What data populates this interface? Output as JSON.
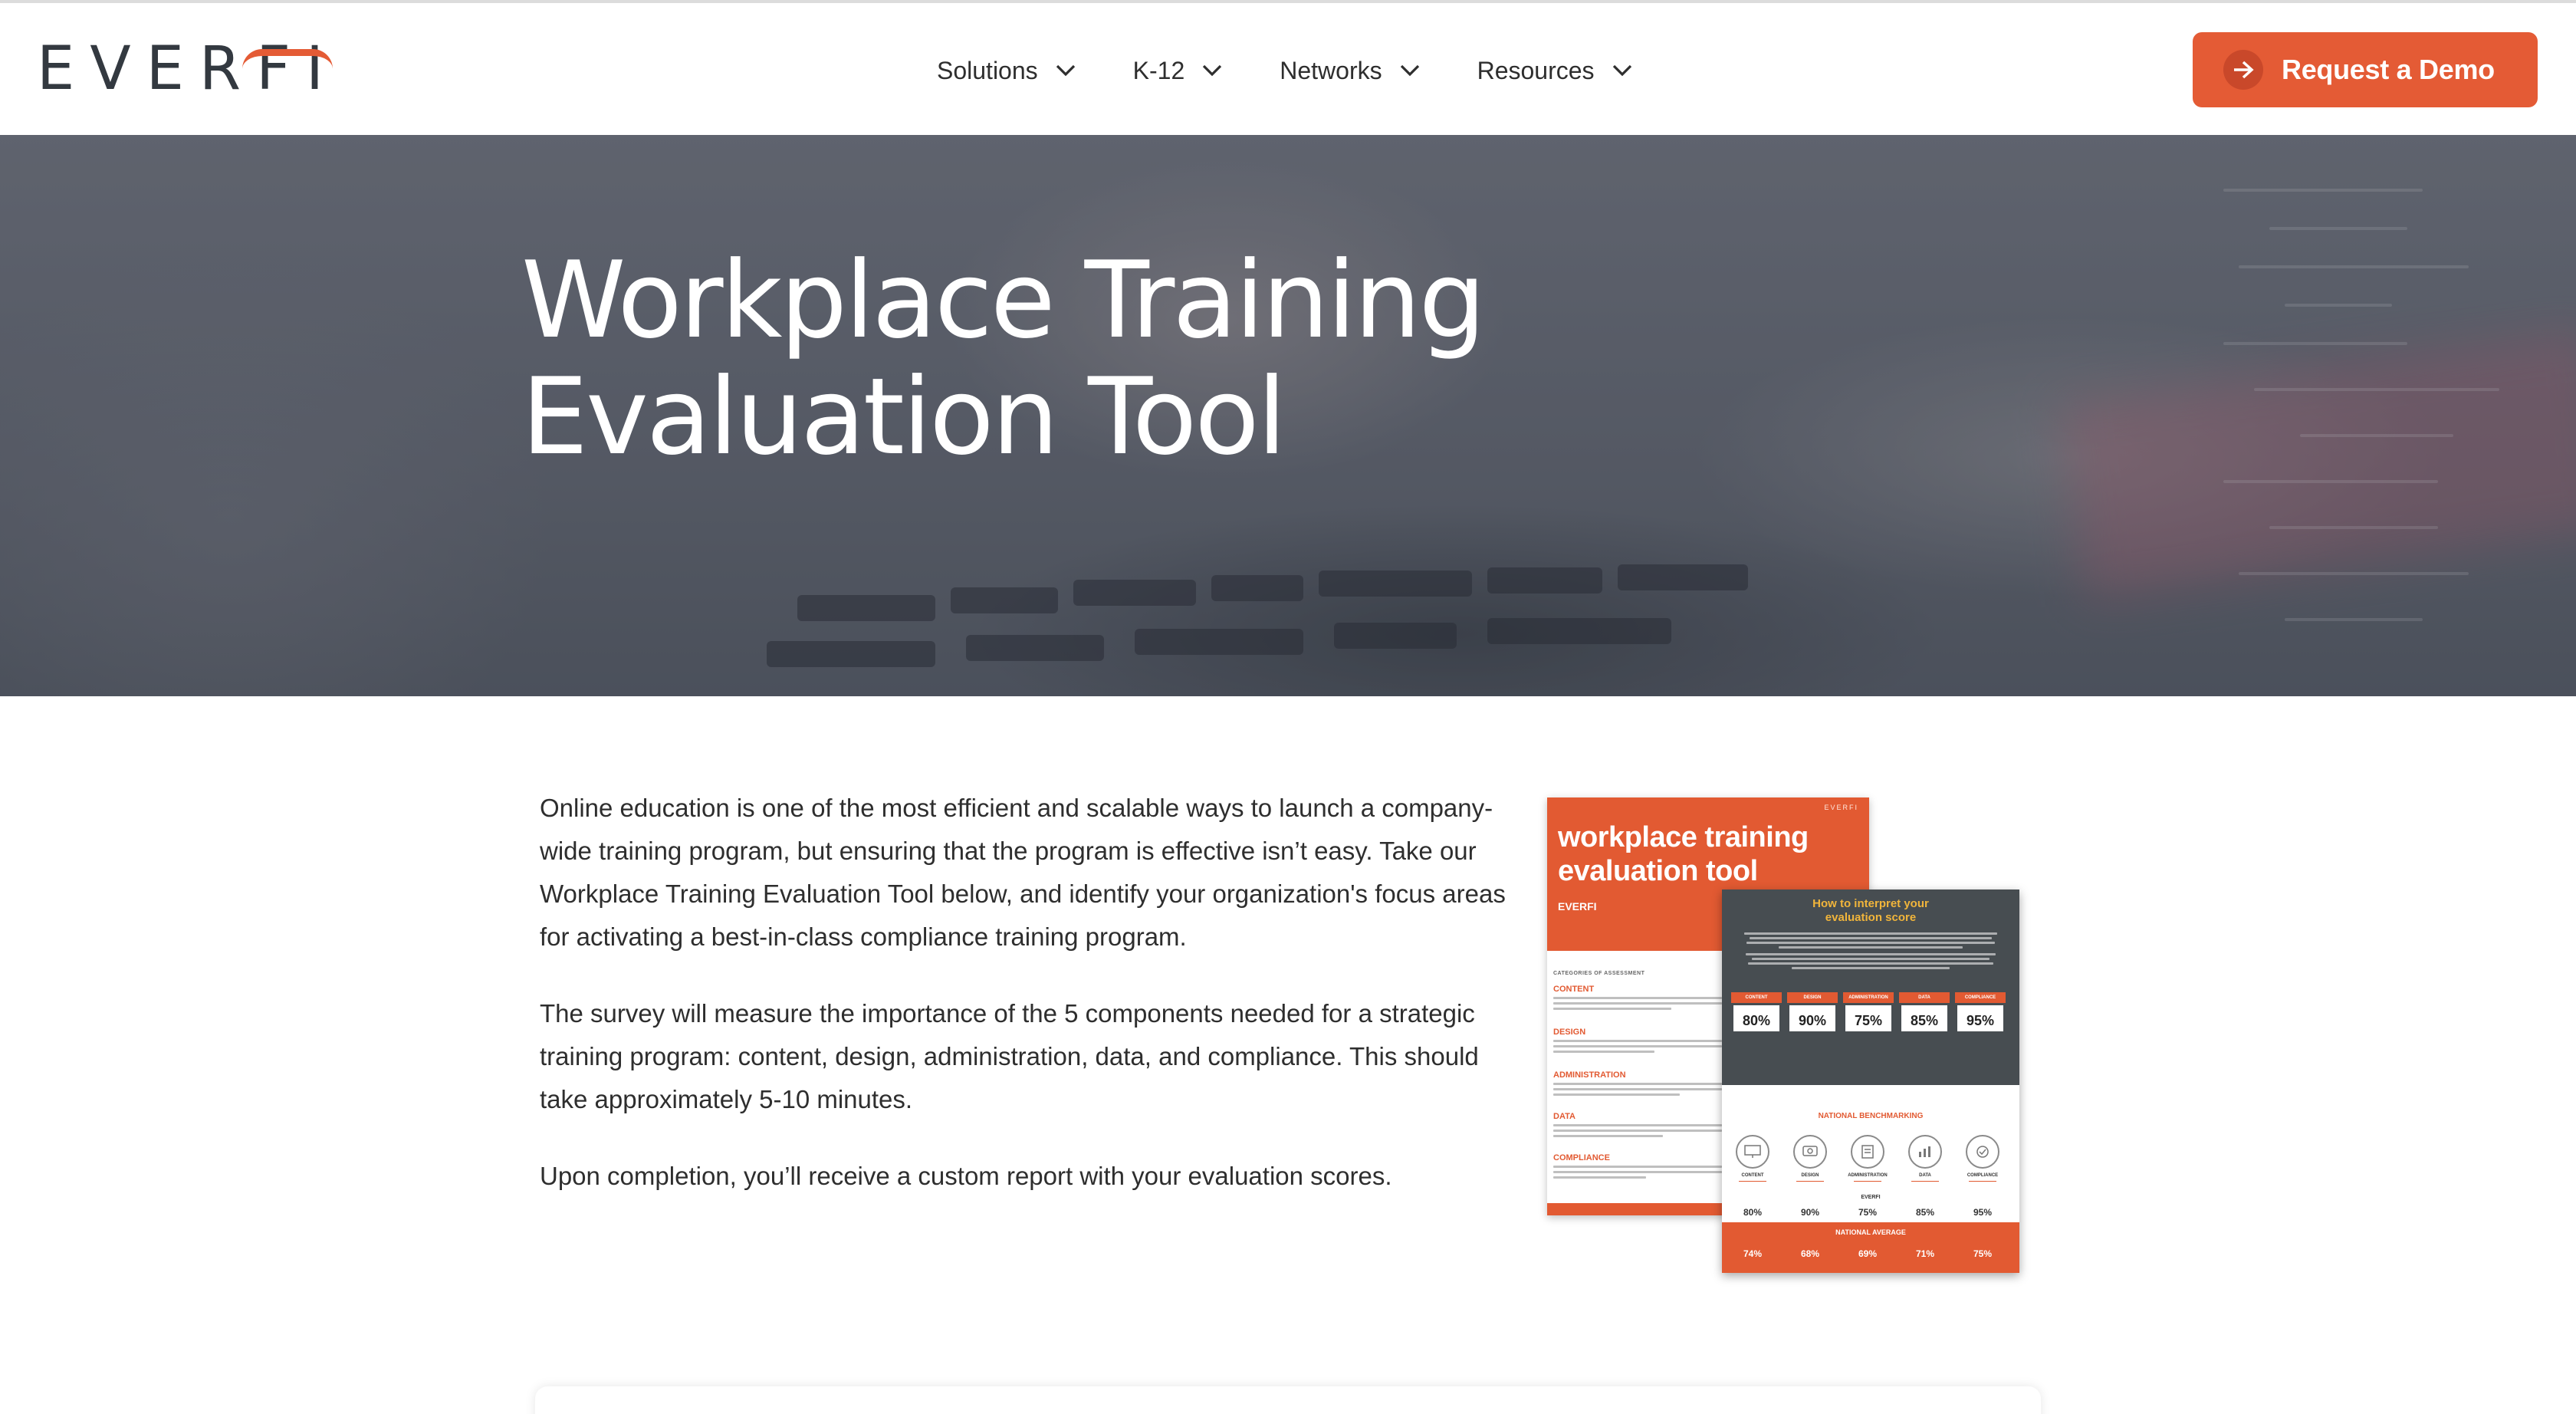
{
  "header": {
    "logo_text": "EVERFI",
    "nav": [
      {
        "label": "Solutions"
      },
      {
        "label": "K-12"
      },
      {
        "label": "Networks"
      },
      {
        "label": "Resources"
      }
    ],
    "cta_label": "Request a Demo"
  },
  "hero": {
    "title_line1": "Workplace Training",
    "title_line2": "Evaluation Tool"
  },
  "intro": {
    "paragraph1": "Online education is one of the most efficient and scalable ways to launch a company-wide training program, but ensuring that the program is effective isn’t easy. Take our Workplace Training Evaluation Tool below, and identify your organization's focus areas for activating a best-in-class compliance training program.",
    "paragraph2": "The survey will measure the importance of the 5 components needed for a strategic training program: content, design, administration, data, and compliance. This should take approximately 5-10 minutes.",
    "paragraph3": "Upon completion, you’ll receive a custom report with your evaluation scores."
  },
  "report_image": {
    "cover_brand": "EVERFI",
    "cover_title": "workplace training evaluation tool",
    "cover_sub": "EVERFI",
    "categories_heading": "CATEGORIES OF ASSESSMENT",
    "categories": [
      "CONTENT",
      "DESIGN",
      "ADMINISTRATION",
      "DATA",
      "COMPLIANCE"
    ],
    "interpret_title": "How to interpret your evaluation score",
    "score_labels": [
      "CONTENT",
      "DESIGN",
      "ADMINISTRATION",
      "DATA",
      "COMPLIANCE"
    ],
    "scores": [
      "80%",
      "90%",
      "75%",
      "85%",
      "95%"
    ],
    "benchmark_title": "NATIONAL BENCHMARKING",
    "benchmark_names": [
      "CONTENT",
      "DESIGN",
      "ADMINISTRATION",
      "DATA",
      "COMPLIANCE"
    ],
    "benchmark_brand": "EVERFI",
    "benchmark_values": [
      "80%",
      "90%",
      "75%",
      "85%",
      "95%"
    ],
    "average_title": "NATIONAL AVERAGE",
    "average_values": [
      "74%",
      "68%",
      "69%",
      "71%",
      "75%"
    ]
  },
  "colors": {
    "accent": "#e45b35",
    "logo_dark": "#333940",
    "report_dark": "#474d51",
    "report_gold": "#f1b53b"
  },
  "icons": {
    "nav_chevron": "chevron-down-icon",
    "cta": "arrow-right-circle-icon"
  }
}
